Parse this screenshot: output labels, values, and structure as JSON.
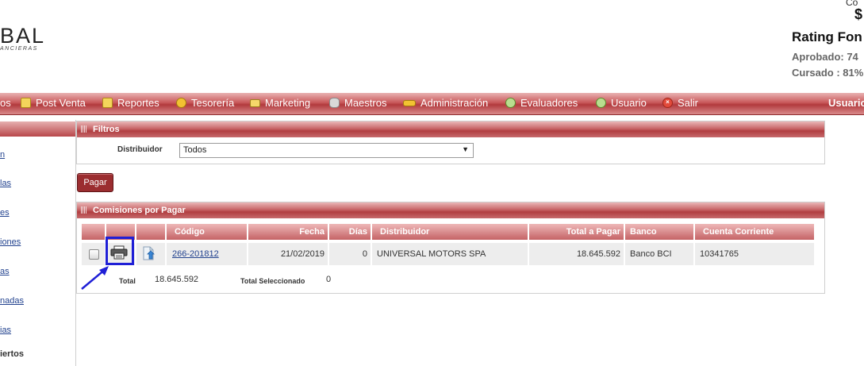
{
  "header": {
    "logo_text": "BAL",
    "logo_subtext": "ANCIERAS",
    "top_small": "Co",
    "top_dollar": "$",
    "rating_title": "Rating Fon",
    "aprobado": "Aprobado: 74",
    "cursado": "Cursado : 81%"
  },
  "nav": {
    "items": [
      {
        "label": "os",
        "icon": ""
      },
      {
        "label": "Post Venta",
        "icon": "folder-icon"
      },
      {
        "label": "Reportes",
        "icon": "folder-icon"
      },
      {
        "label": "Tesorería",
        "icon": "coin-icon"
      },
      {
        "label": "Marketing",
        "icon": "ticket-icon"
      },
      {
        "label": "Maestros",
        "icon": "database-icon"
      },
      {
        "label": "Administración",
        "icon": "key-icon"
      },
      {
        "label": "Evaluadores",
        "icon": "user-icon"
      },
      {
        "label": "Usuario",
        "icon": "user-icon"
      },
      {
        "label": "Salir",
        "icon": "exit-icon"
      }
    ],
    "right_label": "Usuario"
  },
  "sidebar": {
    "links": [
      "n",
      "las",
      "es",
      "iones",
      "as",
      "nadas",
      "ias"
    ],
    "bold_item": "iertos"
  },
  "filters": {
    "title": "Filtros",
    "distribuidor_label": "Distribuidor",
    "distribuidor_value": "Todos"
  },
  "pagar_label": "Pagar",
  "comisiones": {
    "title": "Comisiones por Pagar",
    "columns": [
      "Código",
      "Fecha",
      "Días",
      "Distribuidor",
      "Total a Pagar",
      "Banco",
      "Cuenta Corriente"
    ],
    "rows": [
      {
        "codigo": "266-201812",
        "fecha": "21/02/2019",
        "dias": "0",
        "distribuidor": "UNIVERSAL MOTORS SPA",
        "total": "18.645.592",
        "banco": "Banco BCI",
        "cuenta": "10341765"
      }
    ],
    "total_label": "Total",
    "total_value": "18.645.592",
    "total_sel_label": "Total Seleccionado",
    "total_sel_value": "0"
  },
  "colors": {
    "accent": "#b23a3d",
    "annotation": "#1f1fd6"
  }
}
